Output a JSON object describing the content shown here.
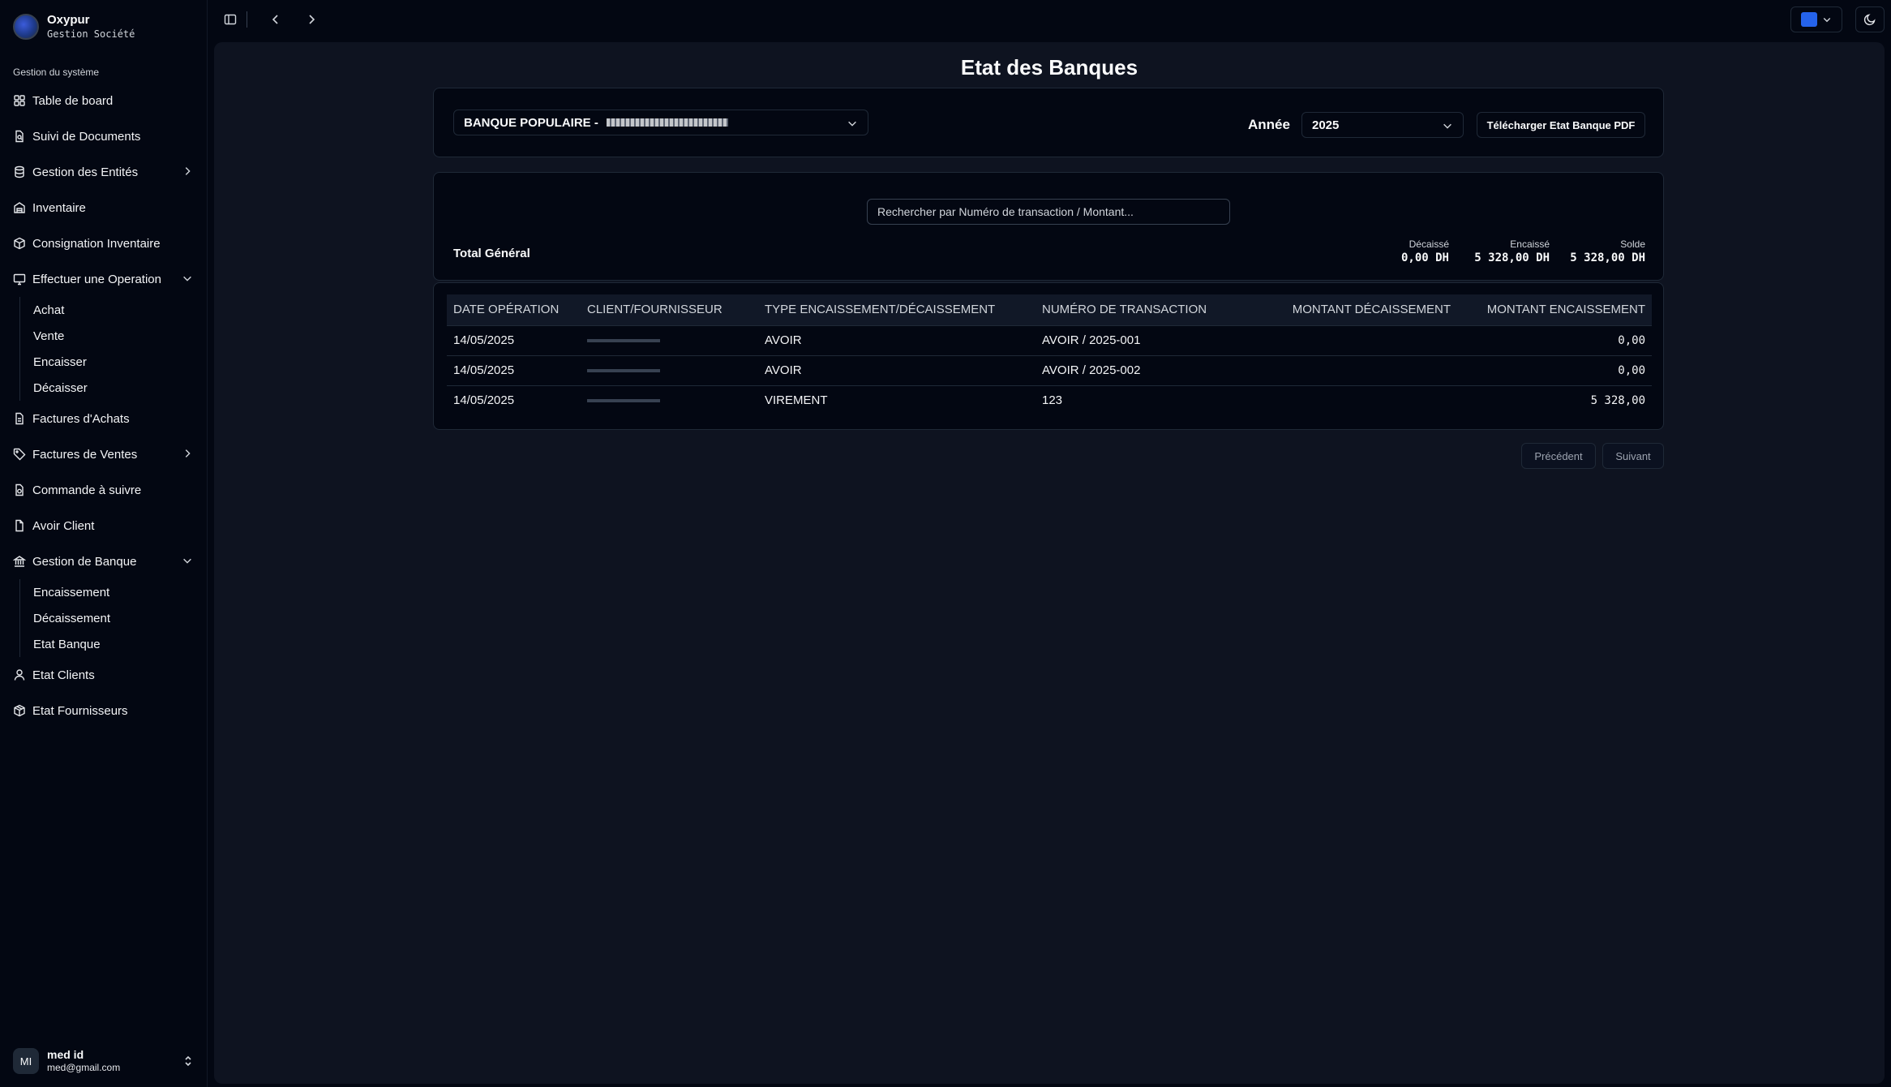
{
  "brand": {
    "name": "Oxypur",
    "subtitle": "Gestion Société"
  },
  "sidebar": {
    "section_label": "Gestion du système",
    "items": [
      {
        "label": "Table de board",
        "icon": "dashboard-icon"
      },
      {
        "label": "Suivi de Documents",
        "icon": "document-search-icon"
      },
      {
        "label": "Gestion des Entités",
        "icon": "database-icon",
        "chevron": "right"
      },
      {
        "label": "Inventaire",
        "icon": "warehouse-icon"
      },
      {
        "label": "Consignation Inventaire",
        "icon": "package-icon"
      },
      {
        "label": "Effectuer une Operation",
        "icon": "monitor-icon",
        "chevron": "down",
        "sub": [
          "Achat",
          "Vente",
          "Encaisser",
          "Décaisser"
        ]
      },
      {
        "label": "Factures d'Achats",
        "icon": "receipt-icon"
      },
      {
        "label": "Factures de Ventes",
        "icon": "tag-icon",
        "chevron": "right"
      },
      {
        "label": "Commande à suivre",
        "icon": "order-icon"
      },
      {
        "label": "Avoir Client",
        "icon": "file-icon"
      },
      {
        "label": "Gestion de Banque",
        "icon": "bank-icon",
        "chevron": "down",
        "sub": [
          "Encaissement",
          "Décaissement",
          "Etat Banque"
        ]
      },
      {
        "label": "Etat Clients",
        "icon": "user-icon"
      },
      {
        "label": "Etat Fournisseurs",
        "icon": "box-icon"
      }
    ]
  },
  "user": {
    "initials": "MI",
    "name": "med id",
    "email": "med@gmail.com"
  },
  "topbar": {
    "accent_color": "#2563eb"
  },
  "page": {
    "title": "Etat des Banques",
    "bank_select": "BANQUE POPULAIRE - ",
    "year_label": "Année",
    "year_value": "2025",
    "download_button": "Télécharger Etat Banque PDF",
    "search_placeholder": "Rechercher par Numéro de transaction / Montant...",
    "total_label": "Total Général",
    "stats": {
      "decaisse_label": "Décaissé",
      "decaisse_value": "0,00 DH",
      "encaisse_label": "Encaissé",
      "encaisse_value": "5 328,00 DH",
      "solde_label": "Solde",
      "solde_value": "5 328,00 DH"
    }
  },
  "table": {
    "headers": [
      "DATE OPÉRATION",
      "CLIENT/FOURNISSEUR",
      "TYPE ENCAISSEMENT/DÉCAISSEMENT",
      "NUMÉRO DE TRANSACTION",
      "MONTANT DÉCAISSEMENT",
      "MONTANT ENCAISSEMENT"
    ],
    "rows": [
      {
        "date": "14/05/2025",
        "client": "",
        "type": "AVOIR",
        "numero": "AVOIR /  2025-001",
        "decaissement": "",
        "encaissement": "0,00"
      },
      {
        "date": "14/05/2025",
        "client": "",
        "type": "AVOIR",
        "numero": "AVOIR /  2025-002",
        "decaissement": "",
        "encaissement": "0,00"
      },
      {
        "date": "14/05/2025",
        "client": "",
        "type": "VIREMENT",
        "numero": "123",
        "decaissement": "",
        "encaissement": "5 328,00"
      }
    ]
  },
  "pagination": {
    "prev": "Précédent",
    "next": "Suivant"
  }
}
